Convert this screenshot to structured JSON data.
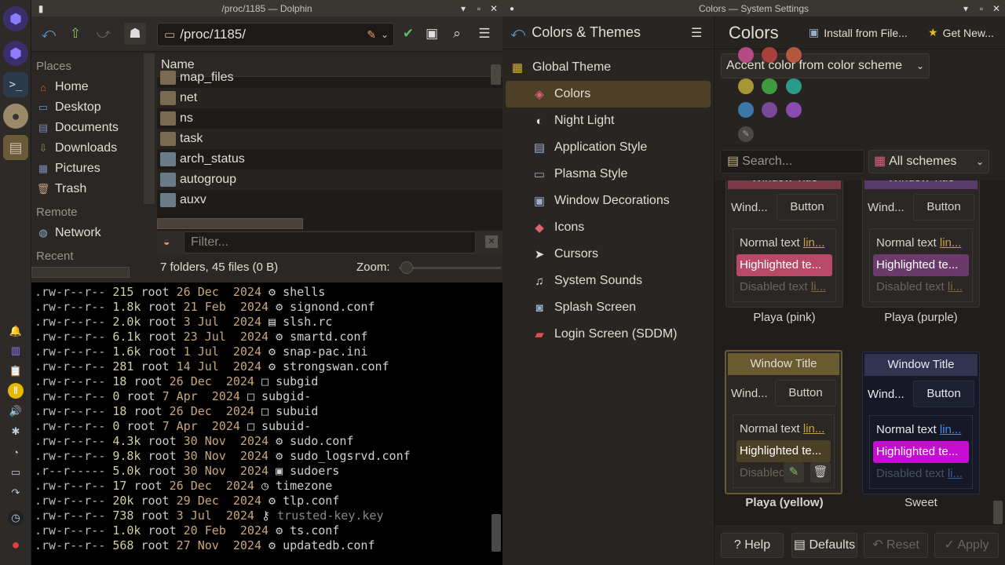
{
  "dolphin": {
    "title": "/proc/1185 — Dolphin",
    "path": "/proc/1185/",
    "places_header": "Places",
    "places": [
      "Home",
      "Desktop",
      "Documents",
      "Downloads",
      "Pictures",
      "Trash"
    ],
    "remote_header": "Remote",
    "remote": [
      "Network"
    ],
    "recent_header": "Recent",
    "column_name": "Name",
    "files": [
      "map_files",
      "net",
      "ns",
      "task",
      "arch_status",
      "autogroup",
      "auxv"
    ],
    "filter_placeholder": "Filter...",
    "status": "7 folders, 45 files (0 B)",
    "zoom_label": "Zoom:"
  },
  "terminal": {
    "rows": [
      {
        "perm": ".rw-r--r--",
        "size": "215",
        "user": "root",
        "day": "26",
        "mon": "Dec",
        "year": "2024",
        "icon": "⚙",
        "name": "shells"
      },
      {
        "perm": ".rw-r--r--",
        "size": "1.8k",
        "user": "root",
        "day": "21",
        "mon": "Feb",
        "year": "2024",
        "icon": "⚙",
        "name": "signond.conf"
      },
      {
        "perm": ".rw-r--r--",
        "size": "2.0k",
        "user": "root",
        "day": "3",
        "mon": "Jul",
        "year": "2024",
        "icon": "▤",
        "name": "slsh.rc"
      },
      {
        "perm": ".rw-r--r--",
        "size": "6.1k",
        "user": "root",
        "day": "23",
        "mon": "Jul",
        "year": "2024",
        "icon": "⚙",
        "name": "smartd.conf"
      },
      {
        "perm": ".rw-r--r--",
        "size": "1.6k",
        "user": "root",
        "day": "1",
        "mon": "Jul",
        "year": "2024",
        "icon": "⚙",
        "name": "snap-pac.ini"
      },
      {
        "perm": ".rw-r--r--",
        "size": "281",
        "user": "root",
        "day": "14",
        "mon": "Jul",
        "year": "2024",
        "icon": "⚙",
        "name": "strongswan.conf"
      },
      {
        "perm": ".rw-r--r--",
        "size": "18",
        "user": "root",
        "day": "26",
        "mon": "Dec",
        "year": "2024",
        "icon": "□",
        "name": "subgid"
      },
      {
        "perm": ".rw-r--r--",
        "size": "0",
        "user": "root",
        "day": "7",
        "mon": "Apr",
        "year": "2024",
        "icon": "□",
        "name": "subgid-"
      },
      {
        "perm": ".rw-r--r--",
        "size": "18",
        "user": "root",
        "day": "26",
        "mon": "Dec",
        "year": "2024",
        "icon": "□",
        "name": "subuid"
      },
      {
        "perm": ".rw-r--r--",
        "size": "0",
        "user": "root",
        "day": "7",
        "mon": "Apr",
        "year": "2024",
        "icon": "□",
        "name": "subuid-"
      },
      {
        "perm": ".rw-r--r--",
        "size": "4.3k",
        "user": "root",
        "day": "30",
        "mon": "Nov",
        "year": "2024",
        "icon": "⚙",
        "name": "sudo.conf"
      },
      {
        "perm": ".rw-r--r--",
        "size": "9.8k",
        "user": "root",
        "day": "30",
        "mon": "Nov",
        "year": "2024",
        "icon": "⚙",
        "name": "sudo_logsrvd.conf"
      },
      {
        "perm": ".r--r-----",
        "size": "5.0k",
        "user": "root",
        "day": "30",
        "mon": "Nov",
        "year": "2024",
        "icon": "▣",
        "name": "sudoers"
      },
      {
        "perm": ".rw-r--r--",
        "size": "17",
        "user": "root",
        "day": "26",
        "mon": "Dec",
        "year": "2024",
        "icon": "◷",
        "name": "timezone"
      },
      {
        "perm": ".rw-r--r--",
        "size": "20k",
        "user": "root",
        "day": "29",
        "mon": "Dec",
        "year": "2024",
        "icon": "⚙",
        "name": "tlp.conf"
      },
      {
        "perm": ".rw-r--r--",
        "size": "738",
        "user": "root",
        "day": "3",
        "mon": "Jul",
        "year": "2024",
        "icon": "⚷",
        "name": "trusted-key.key"
      },
      {
        "perm": ".rw-r--r--",
        "size": "1.0k",
        "user": "root",
        "day": "20",
        "mon": "Feb",
        "year": "2024",
        "icon": "⚙",
        "name": "ts.conf"
      },
      {
        "perm": ".rw-r--r--",
        "size": "568",
        "user": "root",
        "day": "27",
        "mon": "Nov",
        "year": "2024",
        "icon": "⚙",
        "name": "updatedb.conf"
      }
    ]
  },
  "settings": {
    "title": "Colors — System Settings",
    "category": "Colors & Themes",
    "items": [
      "Global Theme",
      "Colors",
      "Night Light",
      "Application Style",
      "Plasma Style",
      "Window Decorations",
      "Icons",
      "Cursors",
      "System Sounds",
      "Splash Screen",
      "Login Screen (SDDM)"
    ],
    "page_title": "Colors",
    "install_label": "Install from File...",
    "getnew_label": "Get New...",
    "accent_label": "Accent color from color scheme",
    "search_placeholder": "Search...",
    "schemes_label": "All schemes",
    "card_window_title": "Window Title",
    "card_window": "Wind...",
    "card_button": "Button",
    "card_normal": "Normal text",
    "card_link": "lin...",
    "card_link_short": "li...",
    "card_highlight": "Highlighted te...",
    "card_disabled": "Disabled text",
    "card_disabled_short": "Disabled",
    "schemes": [
      "Playa (pink)",
      "Playa (purple)",
      "Playa (yellow)",
      "Sweet"
    ],
    "help_label": "Help",
    "defaults_label": "Defaults",
    "reset_label": "Reset",
    "apply_label": "Apply",
    "swatches": [
      "#b54a85",
      "#a8403e",
      "#b2583c",
      "#a89632",
      "#3d9a3d",
      "#2a9a8a",
      "#3a78a8",
      "#7a4a9a",
      "#8a4ab0",
      "#4a4846"
    ]
  }
}
